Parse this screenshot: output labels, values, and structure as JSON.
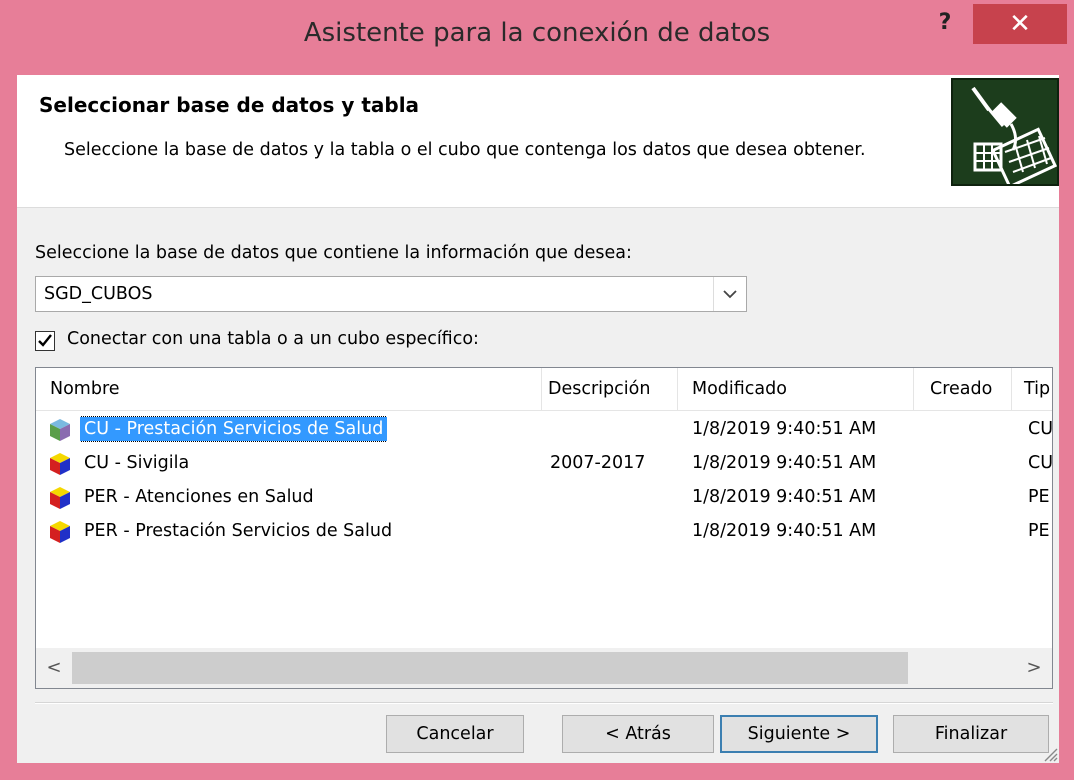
{
  "window": {
    "title": "Asistente para la conexión de datos",
    "help_label": "?",
    "close_label": "✕"
  },
  "header": {
    "title": "Seleccionar base de datos y tabla",
    "subtitle": "Seleccione la base de datos y la tabla o el cubo que contenga los datos que desea obtener."
  },
  "database": {
    "label": "Seleccione la base de datos que contiene la información que desea:",
    "selected": "SGD_CUBOS"
  },
  "connect_checkbox": {
    "label": "Conectar con una tabla o a un cubo específico:",
    "checked": true
  },
  "table": {
    "columns": [
      "Nombre",
      "Descripción",
      "Modificado",
      "Creado",
      "Tip"
    ],
    "rows": [
      {
        "name": "CU - Prestación Servicios de Salud",
        "description": "",
        "modified": "1/8/2019 9:40:51 AM",
        "created": "",
        "type": "CU",
        "selected": true
      },
      {
        "name": "CU - Sivigila",
        "description": "2007-2017",
        "modified": "1/8/2019 9:40:51 AM",
        "created": "",
        "type": "CU",
        "selected": false
      },
      {
        "name": "PER - Atenciones en Salud",
        "description": "",
        "modified": "1/8/2019 9:40:51 AM",
        "created": "",
        "type": "PE",
        "selected": false
      },
      {
        "name": "PER - Prestación Servicios de Salud",
        "description": "",
        "modified": "1/8/2019 9:40:51 AM",
        "created": "",
        "type": "PE",
        "selected": false
      }
    ]
  },
  "scrollbar": {
    "left": "<",
    "right": ">"
  },
  "buttons": {
    "cancel": "Cancelar",
    "back": "< Atrás",
    "next": "Siguiente >",
    "finish": "Finalizar"
  }
}
